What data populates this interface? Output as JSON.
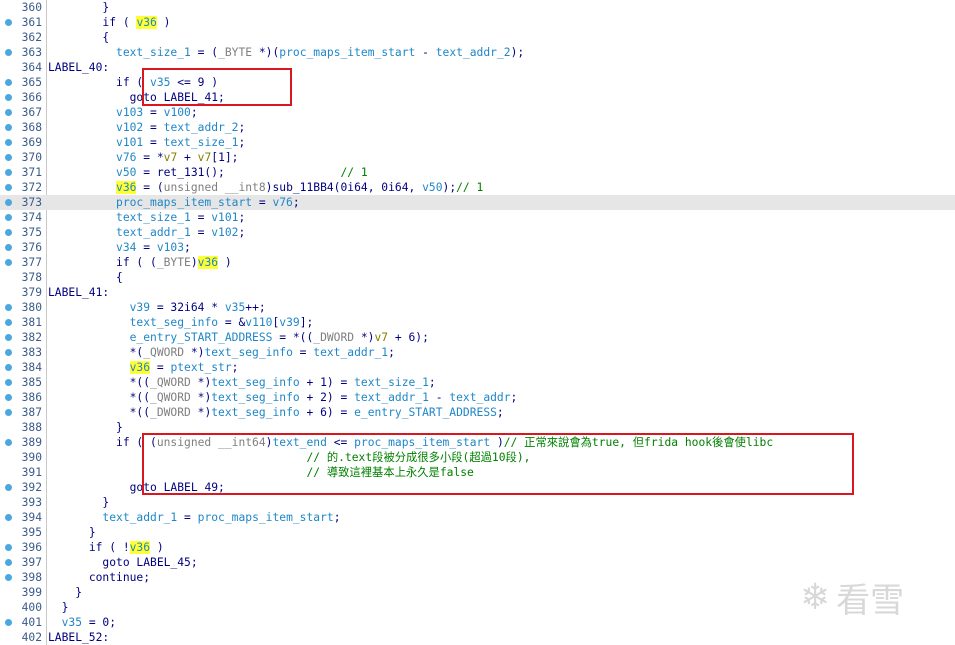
{
  "lines": [
    {
      "n": "360",
      "bp": false,
      "ind": "        ",
      "tokens": [
        [
          "k",
          "}"
        ]
      ]
    },
    {
      "n": "361",
      "bp": true,
      "ind": "        ",
      "tokens": [
        [
          "k",
          "if ( "
        ],
        [
          "y",
          "v36"
        ],
        [
          "k",
          " )"
        ]
      ]
    },
    {
      "n": "362",
      "bp": false,
      "ind": "        ",
      "tokens": [
        [
          "k",
          "{"
        ]
      ]
    },
    {
      "n": "363",
      "bp": true,
      "ind": "          ",
      "tokens": [
        [
          "v",
          "text_size_1"
        ],
        [
          "k",
          " = ("
        ],
        [
          "g",
          "_BYTE"
        ],
        [
          "k",
          " *)("
        ],
        [
          "v",
          "proc_maps_item_start"
        ],
        [
          "k",
          " - "
        ],
        [
          "v",
          "text_addr_2"
        ],
        [
          "k",
          ");"
        ]
      ]
    },
    {
      "n": "364",
      "bp": false,
      "ind": "",
      "tokens": [
        [
          "k",
          "LABEL_40:"
        ]
      ]
    },
    {
      "n": "365",
      "bp": true,
      "ind": "          ",
      "tokens": [
        [
          "k",
          "if ( "
        ],
        [
          "v",
          "v35"
        ],
        [
          "k",
          " <= 9 )"
        ]
      ]
    },
    {
      "n": "366",
      "bp": true,
      "ind": "            ",
      "tokens": [
        [
          "k",
          "goto LABEL_41;"
        ]
      ]
    },
    {
      "n": "367",
      "bp": true,
      "ind": "          ",
      "tokens": [
        [
          "v",
          "v103"
        ],
        [
          "k",
          " = "
        ],
        [
          "v",
          "v100"
        ],
        [
          "k",
          ";"
        ]
      ]
    },
    {
      "n": "368",
      "bp": true,
      "ind": "          ",
      "tokens": [
        [
          "v",
          "v102"
        ],
        [
          "k",
          " = "
        ],
        [
          "v",
          "text_addr_2"
        ],
        [
          "k",
          ";"
        ]
      ]
    },
    {
      "n": "369",
      "bp": true,
      "ind": "          ",
      "tokens": [
        [
          "v",
          "v101"
        ],
        [
          "k",
          " = "
        ],
        [
          "v",
          "text_size_1"
        ],
        [
          "k",
          ";"
        ]
      ]
    },
    {
      "n": "370",
      "bp": true,
      "ind": "          ",
      "tokens": [
        [
          "v",
          "v76"
        ],
        [
          "k",
          " = *"
        ],
        [
          "o",
          "v7"
        ],
        [
          "k",
          " + "
        ],
        [
          "o",
          "v7"
        ],
        [
          "k",
          "[1];"
        ]
      ]
    },
    {
      "n": "371",
      "bp": true,
      "ind": "          ",
      "tokens": [
        [
          "v",
          "v50"
        ],
        [
          "k",
          " = ret_131();                 "
        ],
        [
          "c",
          "// 1"
        ]
      ]
    },
    {
      "n": "372",
      "bp": true,
      "ind": "          ",
      "tokens": [
        [
          "y",
          "v36"
        ],
        [
          "k",
          " = ("
        ],
        [
          "g",
          "unsigned __int8"
        ],
        [
          "k",
          ")sub_11BB4(0i64, 0i64, "
        ],
        [
          "v",
          "v50"
        ],
        [
          "k",
          ");"
        ],
        [
          "c",
          "// 1"
        ]
      ]
    },
    {
      "n": "373",
      "bp": true,
      "ind": "          ",
      "hl": true,
      "tokens": [
        [
          "v",
          "proc_maps_item_start"
        ],
        [
          "k",
          " = "
        ],
        [
          "v",
          "v76"
        ],
        [
          "k",
          ";"
        ]
      ]
    },
    {
      "n": "374",
      "bp": true,
      "ind": "          ",
      "tokens": [
        [
          "v",
          "text_size_1"
        ],
        [
          "k",
          " = "
        ],
        [
          "v",
          "v101"
        ],
        [
          "k",
          ";"
        ]
      ]
    },
    {
      "n": "375",
      "bp": true,
      "ind": "          ",
      "tokens": [
        [
          "v",
          "text_addr_1"
        ],
        [
          "k",
          " = "
        ],
        [
          "v",
          "v102"
        ],
        [
          "k",
          ";"
        ]
      ]
    },
    {
      "n": "376",
      "bp": true,
      "ind": "          ",
      "tokens": [
        [
          "v",
          "v34"
        ],
        [
          "k",
          " = "
        ],
        [
          "v",
          "v103"
        ],
        [
          "k",
          ";"
        ]
      ]
    },
    {
      "n": "377",
      "bp": true,
      "ind": "          ",
      "tokens": [
        [
          "k",
          "if ( ("
        ],
        [
          "g",
          "_BYTE"
        ],
        [
          "k",
          ")"
        ],
        [
          "y",
          "v36"
        ],
        [
          "k",
          " )"
        ]
      ]
    },
    {
      "n": "378",
      "bp": false,
      "ind": "          ",
      "tokens": [
        [
          "k",
          "{"
        ]
      ]
    },
    {
      "n": "379",
      "bp": false,
      "ind": "",
      "tokens": [
        [
          "k",
          "LABEL_41:"
        ]
      ]
    },
    {
      "n": "380",
      "bp": true,
      "ind": "            ",
      "tokens": [
        [
          "v",
          "v39"
        ],
        [
          "k",
          " = 32i64 * "
        ],
        [
          "v",
          "v35"
        ],
        [
          "k",
          "++;"
        ]
      ]
    },
    {
      "n": "381",
      "bp": true,
      "ind": "            ",
      "tokens": [
        [
          "v",
          "text_seg_info"
        ],
        [
          "k",
          " = &"
        ],
        [
          "v",
          "v110"
        ],
        [
          "k",
          "["
        ],
        [
          "v",
          "v39"
        ],
        [
          "k",
          "];"
        ]
      ]
    },
    {
      "n": "382",
      "bp": true,
      "ind": "            ",
      "tokens": [
        [
          "v",
          "e_entry_START_ADDRESS"
        ],
        [
          "k",
          " = *(("
        ],
        [
          "g",
          "_DWORD"
        ],
        [
          "k",
          " *)"
        ],
        [
          "o",
          "v7"
        ],
        [
          "k",
          " + 6);"
        ]
      ]
    },
    {
      "n": "383",
      "bp": true,
      "ind": "            ",
      "tokens": [
        [
          "k",
          "*("
        ],
        [
          "g",
          "_QWORD"
        ],
        [
          "k",
          " *)"
        ],
        [
          "v",
          "text_seg_info"
        ],
        [
          "k",
          " = "
        ],
        [
          "v",
          "text_addr_1"
        ],
        [
          "k",
          ";"
        ]
      ]
    },
    {
      "n": "384",
      "bp": true,
      "ind": "            ",
      "tokens": [
        [
          "y",
          "v36"
        ],
        [
          "k",
          " = "
        ],
        [
          "v",
          "ptext_str"
        ],
        [
          "k",
          ";"
        ]
      ]
    },
    {
      "n": "385",
      "bp": true,
      "ind": "            ",
      "tokens": [
        [
          "k",
          "*(("
        ],
        [
          "g",
          "_QWORD"
        ],
        [
          "k",
          " *)"
        ],
        [
          "v",
          "text_seg_info"
        ],
        [
          "k",
          " + 1) = "
        ],
        [
          "v",
          "text_size_1"
        ],
        [
          "k",
          ";"
        ]
      ]
    },
    {
      "n": "386",
      "bp": true,
      "ind": "            ",
      "tokens": [
        [
          "k",
          "*(("
        ],
        [
          "g",
          "_QWORD"
        ],
        [
          "k",
          " *)"
        ],
        [
          "v",
          "text_seg_info"
        ],
        [
          "k",
          " + 2) = "
        ],
        [
          "v",
          "text_addr_1"
        ],
        [
          "k",
          " - "
        ],
        [
          "v",
          "text_addr"
        ],
        [
          "k",
          ";"
        ]
      ]
    },
    {
      "n": "387",
      "bp": true,
      "ind": "            ",
      "tokens": [
        [
          "k",
          "*(("
        ],
        [
          "g",
          "_DWORD"
        ],
        [
          "k",
          " *)"
        ],
        [
          "v",
          "text_seg_info"
        ],
        [
          "k",
          " + 6) = "
        ],
        [
          "v",
          "e_entry_START_ADDRESS"
        ],
        [
          "k",
          ";"
        ]
      ]
    },
    {
      "n": "388",
      "bp": false,
      "ind": "          ",
      "tokens": [
        [
          "k",
          "}"
        ]
      ]
    },
    {
      "n": "389",
      "bp": true,
      "ind": "          ",
      "tokens": [
        [
          "k",
          "if ( ("
        ],
        [
          "g",
          "unsigned __int64"
        ],
        [
          "k",
          ")"
        ],
        [
          "v",
          "text_end"
        ],
        [
          "k",
          " <= "
        ],
        [
          "v",
          "proc_maps_item_start"
        ],
        [
          "k",
          " )"
        ],
        [
          "c",
          "// 正常來說會為true, 但frida hook後會使libc"
        ]
      ]
    },
    {
      "n": "390",
      "bp": false,
      "ind": "                                      ",
      "tokens": [
        [
          "c",
          "// 的.text段被分成很多小段(超過10段),"
        ]
      ]
    },
    {
      "n": "391",
      "bp": false,
      "ind": "                                      ",
      "tokens": [
        [
          "c",
          "// 導致這裡基本上永久是false"
        ]
      ]
    },
    {
      "n": "392",
      "bp": true,
      "ind": "            ",
      "tokens": [
        [
          "k",
          "goto LABEL_49;"
        ]
      ]
    },
    {
      "n": "393",
      "bp": false,
      "ind": "        ",
      "tokens": [
        [
          "k",
          "}"
        ]
      ]
    },
    {
      "n": "394",
      "bp": true,
      "ind": "        ",
      "tokens": [
        [
          "v",
          "text_addr_1"
        ],
        [
          "k",
          " = "
        ],
        [
          "v",
          "proc_maps_item_start"
        ],
        [
          "k",
          ";"
        ]
      ]
    },
    {
      "n": "395",
      "bp": false,
      "ind": "      ",
      "tokens": [
        [
          "k",
          "}"
        ]
      ]
    },
    {
      "n": "396",
      "bp": true,
      "ind": "      ",
      "tokens": [
        [
          "k",
          "if ( !"
        ],
        [
          "y",
          "v36"
        ],
        [
          "k",
          " )"
        ]
      ]
    },
    {
      "n": "397",
      "bp": true,
      "ind": "        ",
      "tokens": [
        [
          "k",
          "goto LABEL_45;"
        ]
      ]
    },
    {
      "n": "398",
      "bp": true,
      "ind": "      ",
      "tokens": [
        [
          "k",
          "continue;"
        ]
      ]
    },
    {
      "n": "399",
      "bp": false,
      "ind": "    ",
      "tokens": [
        [
          "k",
          "}"
        ]
      ]
    },
    {
      "n": "400",
      "bp": false,
      "ind": "  ",
      "tokens": [
        [
          "k",
          "}"
        ]
      ]
    },
    {
      "n": "401",
      "bp": true,
      "ind": "  ",
      "tokens": [
        [
          "v",
          "v35"
        ],
        [
          "k",
          " = 0;"
        ]
      ]
    },
    {
      "n": "402",
      "bp": false,
      "ind": "",
      "tokens": [
        [
          "k",
          "LABEL_52:"
        ]
      ]
    }
  ],
  "watermark": {
    "text": "看雪",
    "icon": "snowflake-icon"
  },
  "colors": {
    "highlight": "#ffff33",
    "box": "#d9171f",
    "variable": "#1f87c7",
    "comment": "#008000"
  }
}
